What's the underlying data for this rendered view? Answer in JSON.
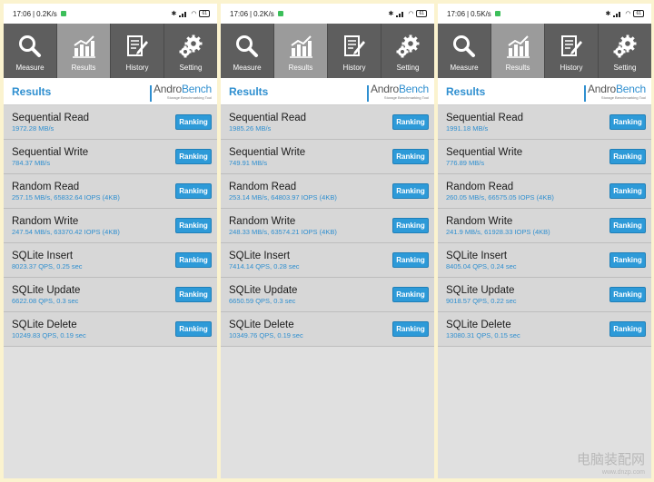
{
  "screens": [
    {
      "status": {
        "time": "17:06",
        "speed": "0.2K/s",
        "battery": "61"
      },
      "tabs": [
        {
          "label": "Measure",
          "icon": "search-icon",
          "active": false
        },
        {
          "label": "Results",
          "icon": "bar-chart-icon",
          "active": true
        },
        {
          "label": "History",
          "icon": "document-edit-icon",
          "active": false
        },
        {
          "label": "Setting",
          "icon": "gear-icon",
          "active": false
        }
      ],
      "header": {
        "title": "Results",
        "logo_prefix": "Andro",
        "logo_suffix": "Bench",
        "logo_sub": "Storage Benchmarking Tool"
      },
      "rows": [
        {
          "title": "Sequential Read",
          "value": "1972.28 MB/s",
          "button": "Ranking"
        },
        {
          "title": "Sequential Write",
          "value": "784.37 MB/s",
          "button": "Ranking"
        },
        {
          "title": "Random Read",
          "value": "257.15 MB/s, 65832.64 IOPS (4KB)",
          "button": "Ranking"
        },
        {
          "title": "Random Write",
          "value": "247.54 MB/s, 63370.42 IOPS (4KB)",
          "button": "Ranking"
        },
        {
          "title": "SQLite Insert",
          "value": "8023.37 QPS, 0.25 sec",
          "button": "Ranking"
        },
        {
          "title": "SQLite Update",
          "value": "6622.08 QPS, 0.3 sec",
          "button": "Ranking"
        },
        {
          "title": "SQLite Delete",
          "value": "10249.83 QPS, 0.19 sec",
          "button": "Ranking"
        }
      ]
    },
    {
      "status": {
        "time": "17:06",
        "speed": "0.2K/s",
        "battery": "61"
      },
      "tabs": [
        {
          "label": "Measure",
          "icon": "search-icon",
          "active": false
        },
        {
          "label": "Results",
          "icon": "bar-chart-icon",
          "active": true
        },
        {
          "label": "History",
          "icon": "document-edit-icon",
          "active": false
        },
        {
          "label": "Setting",
          "icon": "gear-icon",
          "active": false
        }
      ],
      "header": {
        "title": "Results",
        "logo_prefix": "Andro",
        "logo_suffix": "Bench",
        "logo_sub": "Storage Benchmarking Tool"
      },
      "rows": [
        {
          "title": "Sequential Read",
          "value": "1985.26 MB/s",
          "button": "Ranking"
        },
        {
          "title": "Sequential Write",
          "value": "749.91 MB/s",
          "button": "Ranking"
        },
        {
          "title": "Random Read",
          "value": "253.14 MB/s, 64803.97 IOPS (4KB)",
          "button": "Ranking"
        },
        {
          "title": "Random Write",
          "value": "248.33 MB/s, 63574.21 IOPS (4KB)",
          "button": "Ranking"
        },
        {
          "title": "SQLite Insert",
          "value": "7414.14 QPS, 0.28 sec",
          "button": "Ranking"
        },
        {
          "title": "SQLite Update",
          "value": "6650.59 QPS, 0.3 sec",
          "button": "Ranking"
        },
        {
          "title": "SQLite Delete",
          "value": "10349.76 QPS, 0.19 sec",
          "button": "Ranking"
        }
      ]
    },
    {
      "status": {
        "time": "17:06",
        "speed": "0.5K/s",
        "battery": "61"
      },
      "tabs": [
        {
          "label": "Measure",
          "icon": "search-icon",
          "active": false
        },
        {
          "label": "Results",
          "icon": "bar-chart-icon",
          "active": true
        },
        {
          "label": "History",
          "icon": "document-edit-icon",
          "active": false
        },
        {
          "label": "Setting",
          "icon": "gear-icon",
          "active": false
        }
      ],
      "header": {
        "title": "Results",
        "logo_prefix": "Andro",
        "logo_suffix": "Bench",
        "logo_sub": "Storage Benchmarking Tool"
      },
      "rows": [
        {
          "title": "Sequential Read",
          "value": "1991.18 MB/s",
          "button": "Ranking"
        },
        {
          "title": "Sequential Write",
          "value": "776.89 MB/s",
          "button": "Ranking"
        },
        {
          "title": "Random Read",
          "value": "260.05 MB/s, 66575.05 IOPS (4KB)",
          "button": "Ranking"
        },
        {
          "title": "Random Write",
          "value": "241.9 MB/s, 61928.33 IOPS (4KB)",
          "button": "Ranking"
        },
        {
          "title": "SQLite Insert",
          "value": "8405.04 QPS, 0.24 sec",
          "button": "Ranking"
        },
        {
          "title": "SQLite Update",
          "value": "9018.57 QPS, 0.22 sec",
          "button": "Ranking"
        },
        {
          "title": "SQLite Delete",
          "value": "13080.31 QPS, 0.15 sec",
          "button": "Ranking"
        }
      ]
    }
  ],
  "watermark": {
    "main": "电脑装配网",
    "sub": "www.dnzp.com"
  },
  "colors": {
    "accent": "#2f8fd0",
    "button": "#2d9ad8",
    "tab_bar": "#5e5e5e",
    "tab_active": "#9b9b9b",
    "row_bg": "#d7d7d7",
    "page_bg": "#fbf3cf"
  }
}
